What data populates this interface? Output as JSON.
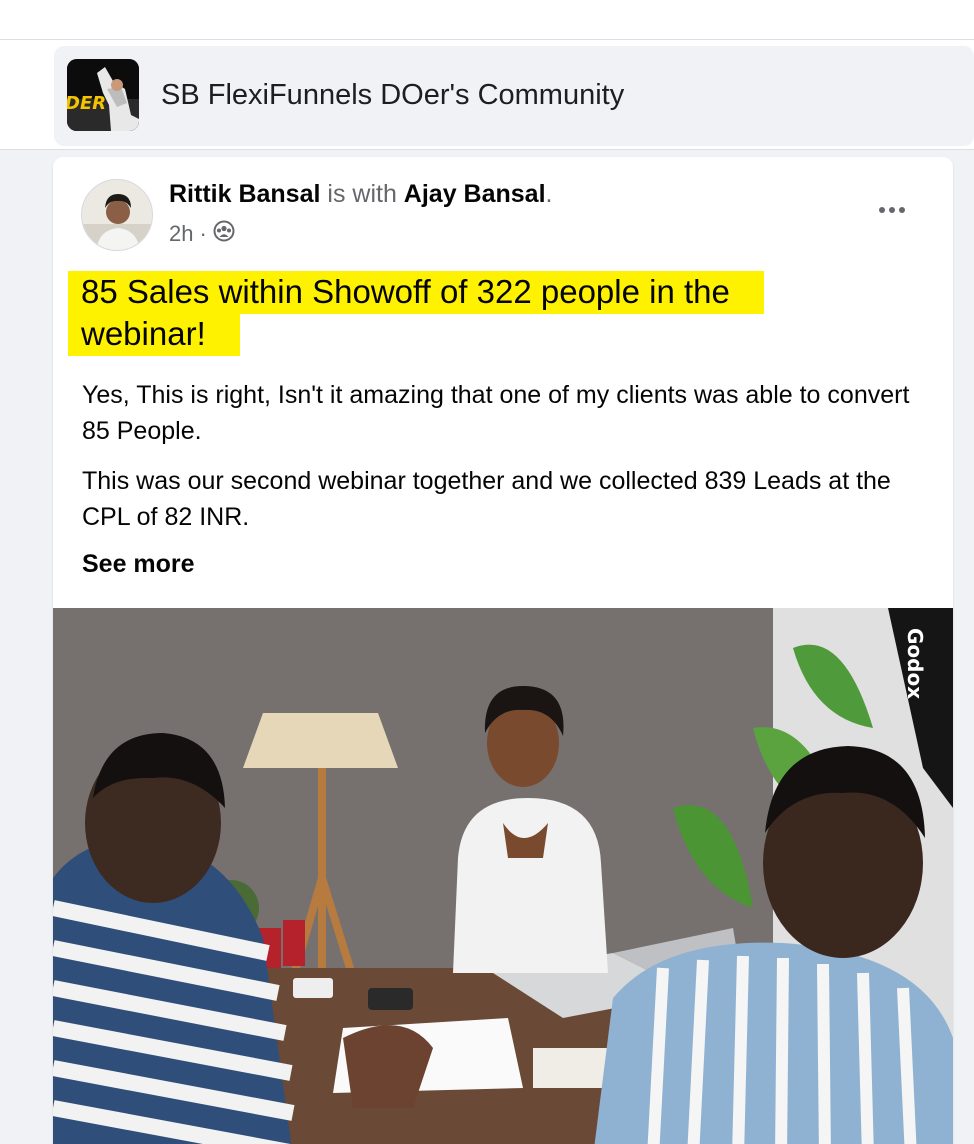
{
  "group": {
    "name": "SB FlexiFunnels DOer's Community",
    "icon_text": "DER",
    "icon_colors": {
      "bg": "#0c0c0c",
      "accent": "#f5c400"
    }
  },
  "post": {
    "author": "Rittik Bansal",
    "with_text": " is with ",
    "tagged": "Ajay Bansal",
    "tail": ".",
    "time": "2h",
    "separator": "·",
    "audience_icon": "group-audience-icon",
    "more_icon": "more-options-icon",
    "more_label": "•••",
    "headline": "85 Sales within Showoff of 322 people in the webinar!",
    "highlight_color": "#fff200",
    "paragraphs": [
      "Yes, This is right, Isn't it amazing that one of my clients was able to convert 85 People.",
      "This was our second webinar together and we collected 839 Leads at the CPL of 82 INR."
    ],
    "see_more": "See more",
    "photo_brand_text": "Godox"
  }
}
